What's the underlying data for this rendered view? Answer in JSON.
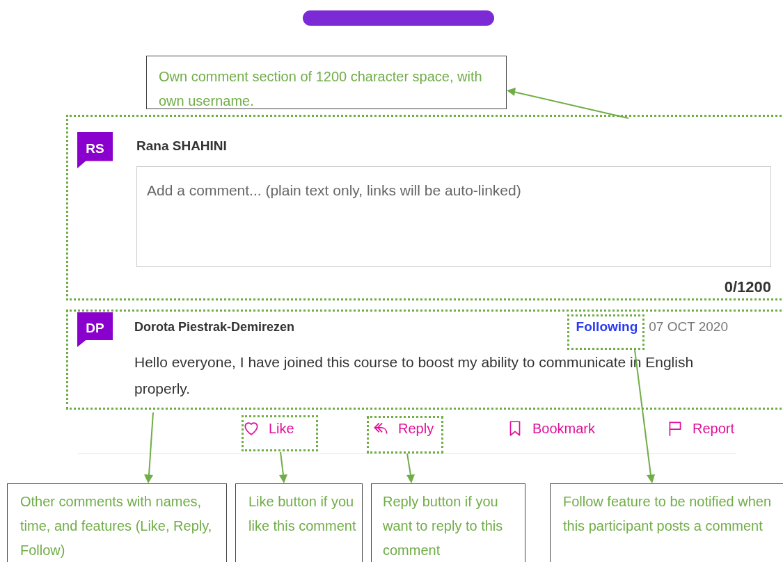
{
  "top_annotation": {
    "text": "Own comment section of 1200 character space, with own username."
  },
  "composer": {
    "avatar": "RS",
    "name": "Rana SHAHINI",
    "placeholder": "Add a comment... (plain text only, links will be auto-linked)",
    "counter": "0/1200"
  },
  "comments": [
    {
      "avatar": "DP",
      "name": "Dorota Piestrak-Demirezen",
      "follow": "Following",
      "date": "07 OCT 2020",
      "body": "Hello everyone, I have joined this course to boost my ability to communicate in English properly.",
      "actions": [
        {
          "kind": "like",
          "label": "Like"
        },
        {
          "kind": "reply",
          "label": "Reply"
        },
        {
          "kind": "bookmark",
          "label": "Bookmark"
        },
        {
          "kind": "report",
          "label": "Report"
        }
      ]
    }
  ],
  "bottom_annotations": [
    {
      "text": "Other comments with names, time, and features (Like, Reply, Follow)"
    },
    {
      "text": "Like button if you like this comment"
    },
    {
      "text": "Reply button if you want to reply to this comment"
    },
    {
      "text": "Follow feature to be notified when this participant posts a comment"
    }
  ]
}
